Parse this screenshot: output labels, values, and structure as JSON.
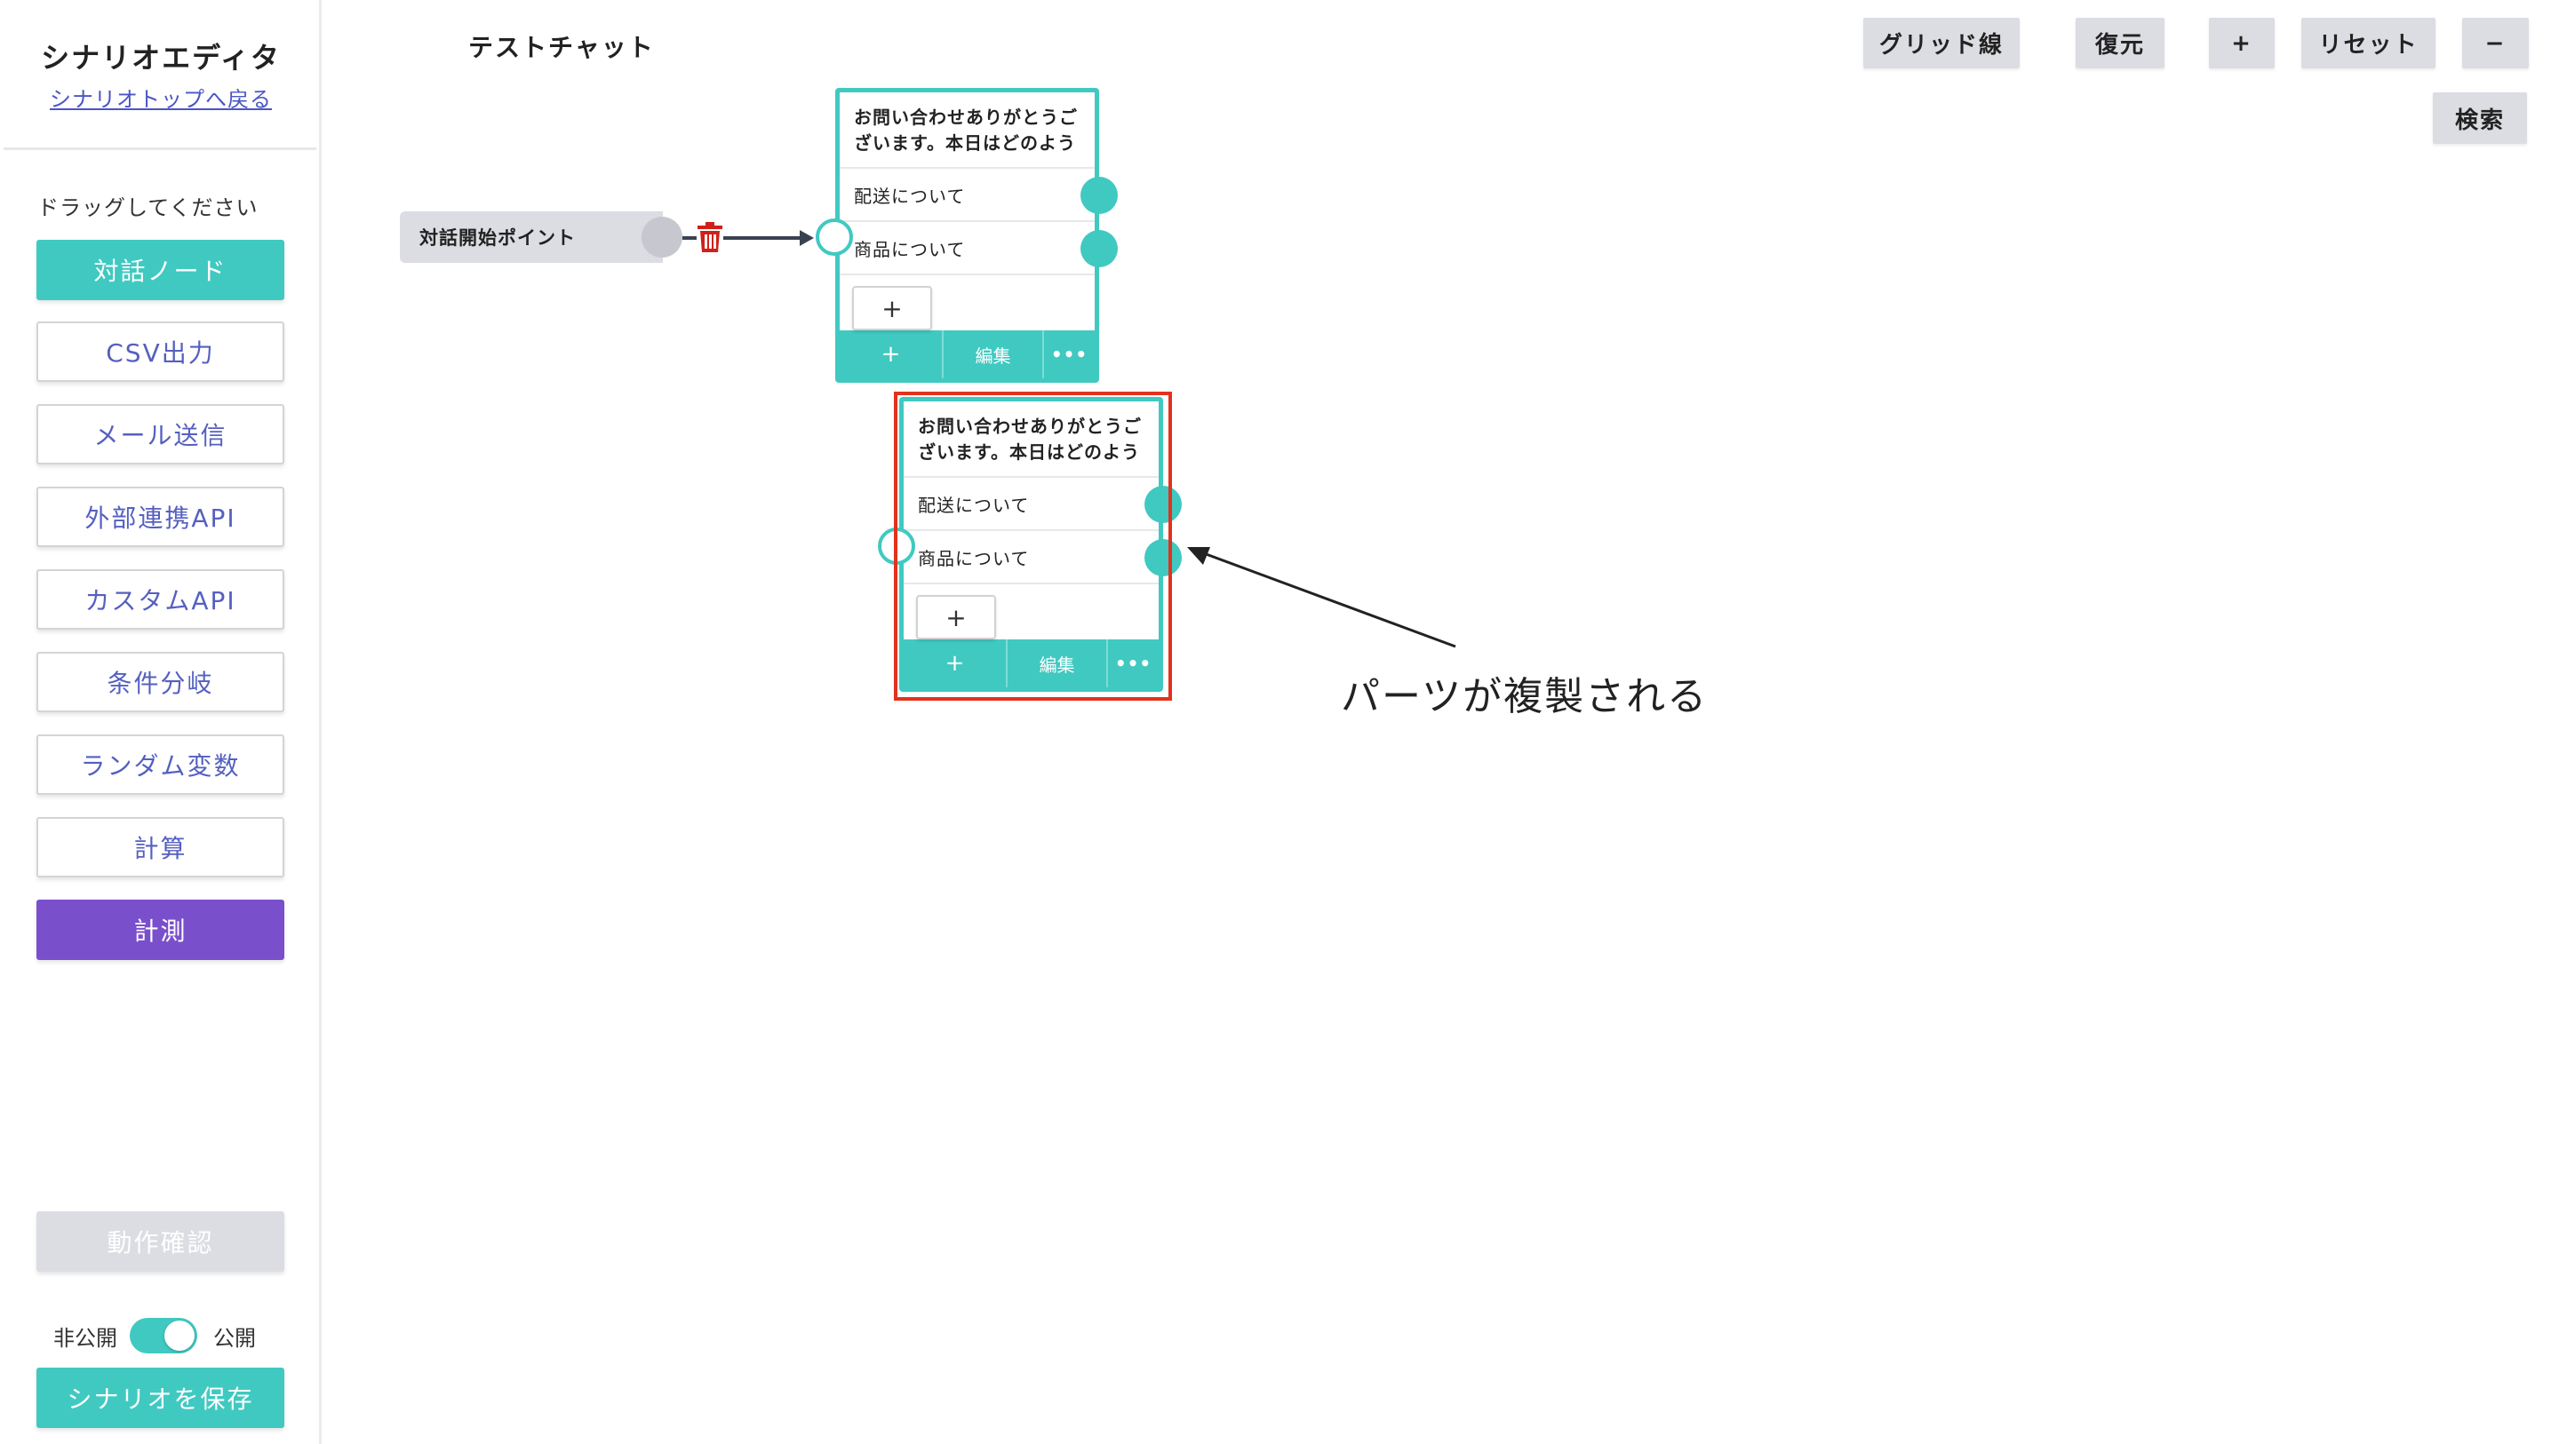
{
  "sidebar": {
    "title": "シナリオエディタ",
    "back_link": "シナリオトップへ戻る",
    "drag_hint": "ドラッグしてください",
    "tools": [
      {
        "label": "対話ノード"
      },
      {
        "label": "CSV出力"
      },
      {
        "label": "メール送信"
      },
      {
        "label": "外部連携API"
      },
      {
        "label": "カスタムAPI"
      },
      {
        "label": "条件分岐"
      },
      {
        "label": "ランダム変数"
      },
      {
        "label": "計算"
      },
      {
        "label": "計測"
      }
    ],
    "test_button": "動作確認",
    "toggle": {
      "off_label": "非公開",
      "on_label": "公開",
      "state": "公開"
    },
    "save_button": "シナリオを保存"
  },
  "header": {
    "chat_name": "テストチャット",
    "buttons": {
      "grid": "グリッド線",
      "restore": "復元",
      "zoom_in": "+",
      "reset": "リセット",
      "zoom_out": "−",
      "search": "検索"
    }
  },
  "canvas": {
    "start_node": {
      "label": "対話開始ポイント"
    },
    "nodes": [
      {
        "message": "お問い合わせありがとうございます。本日はどのよう",
        "options": [
          "配送について",
          "商品について"
        ],
        "add_label": "+",
        "footer": {
          "add": "+",
          "edit": "編集",
          "more": "•••"
        }
      },
      {
        "message": "お問い合わせありがとうございます。本日はどのよう",
        "options": [
          "配送について",
          "商品について"
        ],
        "add_label": "+",
        "footer": {
          "add": "+",
          "edit": "編集",
          "more": "•••"
        }
      }
    ],
    "annotation": "パーツが複製される"
  },
  "colors": {
    "accent_teal": "#40c9c1",
    "accent_purple": "#7a4fcc",
    "link_blue": "#4a55c5",
    "highlight_red": "#e2321e",
    "trash_red": "#d0201a"
  },
  "icons": [
    "trash-icon",
    "arrow-icon"
  ]
}
